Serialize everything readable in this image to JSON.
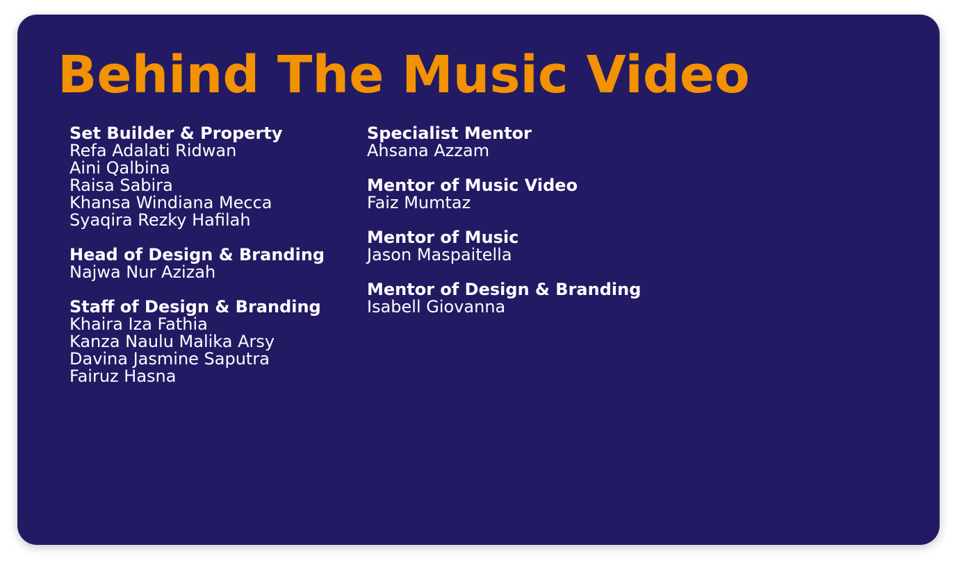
{
  "colors": {
    "background": "#231a64",
    "title": "#f39200",
    "text": "#ffffff"
  },
  "title": "Behind The Music Video",
  "columns": [
    {
      "groups": [
        {
          "role": "Set Builder & Property",
          "people": [
            "Refa Adalati Ridwan",
            "Aini Qalbina",
            "Raisa Sabira",
            "Khansa Windiana Mecca",
            "Syaqira Rezky Hafilah"
          ]
        },
        {
          "role": "Head of Design & Branding",
          "people": [
            "Najwa Nur Azizah"
          ]
        },
        {
          "role": "Staff of Design & Branding",
          "people": [
            "Khaira Iza Fathia",
            "Kanza Naulu Malika Arsy",
            "Davina Jasmine Saputra",
            "Fairuz Hasna"
          ]
        }
      ]
    },
    {
      "groups": [
        {
          "role": "Specialist Mentor",
          "people": [
            "Ahsana Azzam"
          ]
        },
        {
          "role": "Mentor of Music Video",
          "people": [
            "Faiz Mumtaz"
          ]
        },
        {
          "role": "Mentor of Music",
          "people": [
            "Jason Maspaitella"
          ]
        },
        {
          "role": "Mentor of Design & Branding",
          "people": [
            "Isabell Giovanna"
          ]
        }
      ]
    }
  ]
}
